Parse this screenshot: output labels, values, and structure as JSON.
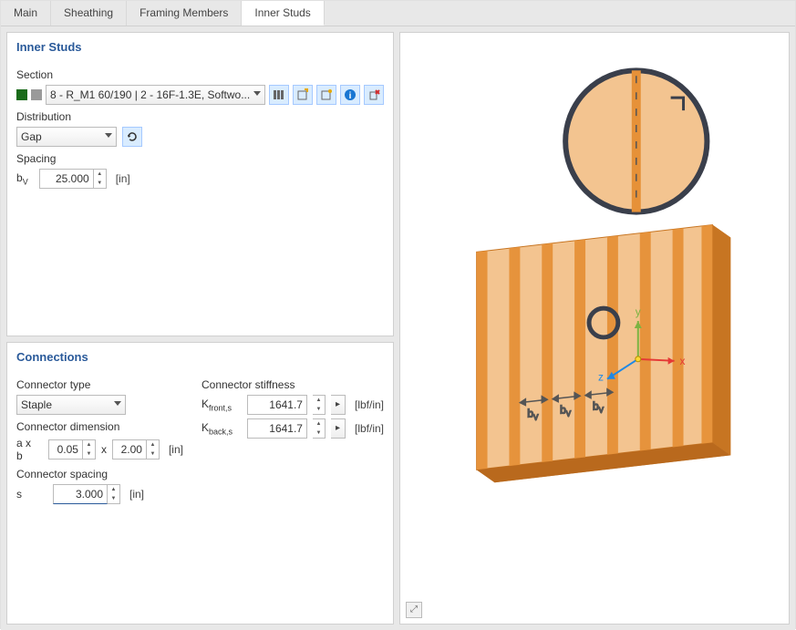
{
  "tabs": [
    "Main",
    "Sheathing",
    "Framing Members",
    "Inner Studs"
  ],
  "active_tab": 3,
  "panel1": {
    "title": "Inner Studs",
    "section_label": "Section",
    "section_value": "8 - R_M1 60/190 | 2 - 16F-1.3E, Softwo...",
    "distribution_label": "Distribution",
    "distribution_value": "Gap",
    "spacing_label": "Spacing",
    "bv_symbol": "b",
    "bv_sub": "V",
    "bv_value": "25.000",
    "bv_unit": "[in]"
  },
  "panel2": {
    "title": "Connections",
    "connector_type_label": "Connector type",
    "connector_type_value": "Staple",
    "connector_dim_label": "Connector dimension",
    "axb_label": "a x b",
    "a_value": "0.05",
    "x_label": "x",
    "b_value": "2.00",
    "dim_unit": "[in]",
    "connector_spacing_label": "Connector spacing",
    "s_label": "s",
    "s_value": "3.000",
    "s_unit": "[in]",
    "stiffness_label": "Connector stiffness",
    "k_front_label": "K",
    "k_front_sub": "front,s",
    "k_front_value": "1641.7",
    "k_front_unit": "[lbf/in]",
    "k_back_label": "K",
    "k_back_sub": "back,s",
    "k_back_value": "1641.7",
    "k_back_unit": "[lbf/in]"
  },
  "viz": {
    "axis_x": "x",
    "axis_y": "y",
    "axis_z": "z",
    "bv_label": "b",
    "bv_sub": "V"
  }
}
